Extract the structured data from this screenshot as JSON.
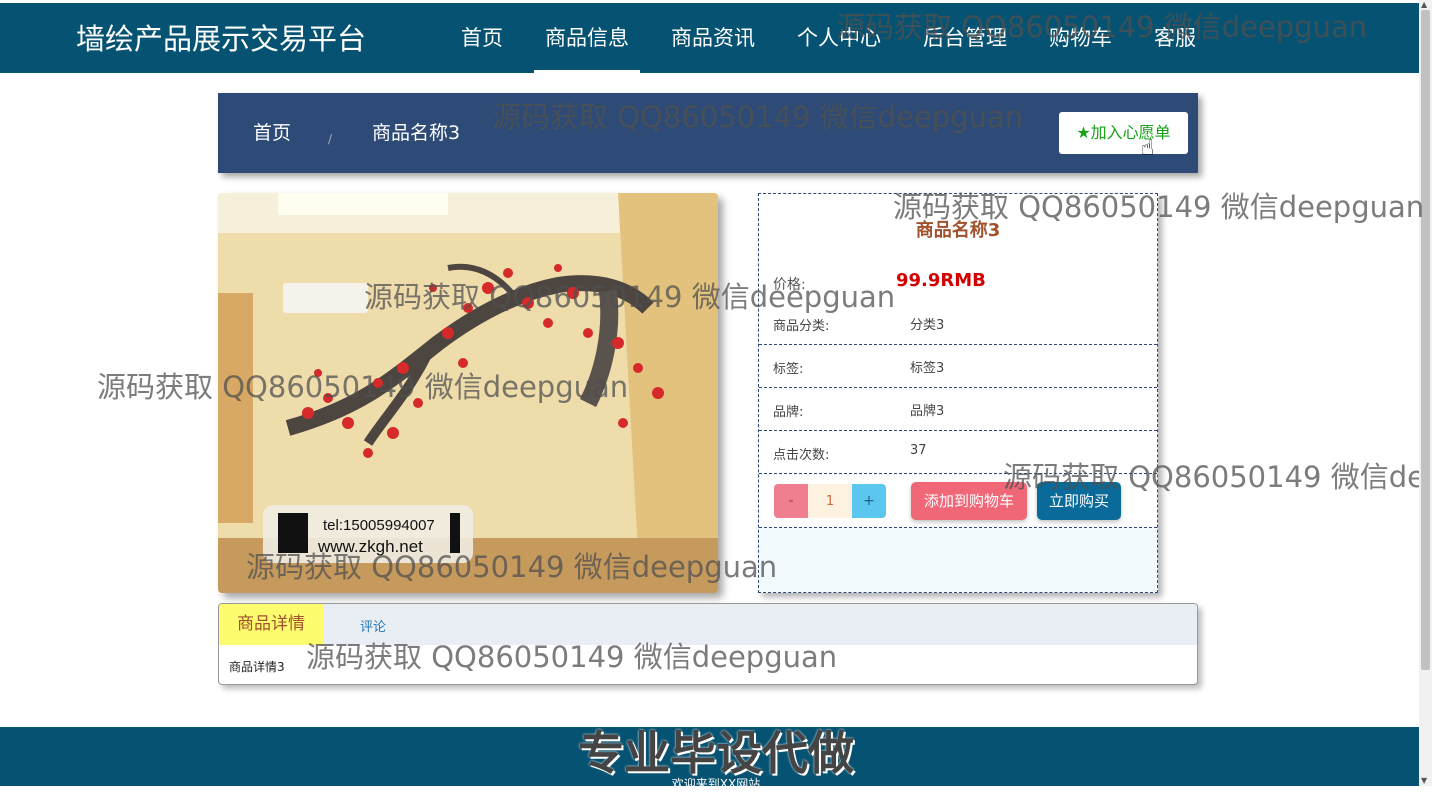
{
  "header": {
    "brand": "墙绘产品展示交易平台",
    "nav": [
      "首页",
      "商品信息",
      "商品资讯",
      "个人中心",
      "后台管理",
      "购物车",
      "客服"
    ],
    "active_nav": "商品信息"
  },
  "breadcrumb": {
    "home": "首页",
    "separator": "/",
    "current": "商品名称3",
    "wish_button": "加入心愿单",
    "wish_icon": "star-icon"
  },
  "product": {
    "image_overlay": {
      "tel": "tel:15005994007",
      "site": "www.zkgh.net"
    },
    "title": "商品名称3",
    "price_label": "价格:",
    "price": "99.9RMB",
    "rows": [
      {
        "label": "商品分类:",
        "value": "分类3"
      },
      {
        "label": "标签:",
        "value": "标签3"
      },
      {
        "label": "品牌:",
        "value": "品牌3"
      },
      {
        "label": "点击次数:",
        "value": "37"
      }
    ],
    "qty_minus": "-",
    "qty_value": "1",
    "qty_plus": "+",
    "add_to_cart": "添加到购物车",
    "buy_now": "立即购买"
  },
  "tabs": {
    "detail": "商品详情",
    "comments": "评论",
    "detail_content": "商品详情3"
  },
  "footer": {
    "title": "专业毕设代做",
    "subtitle": "欢迎来到XX网站"
  },
  "watermark": "源码获取 QQ86050149 微信deepguan",
  "colors": {
    "header_bg": "#065272",
    "breadcrumb_bg": "#2d4b76",
    "price": "#d40000",
    "add_cart": "#f06778",
    "buy_now": "#0a6a99"
  }
}
